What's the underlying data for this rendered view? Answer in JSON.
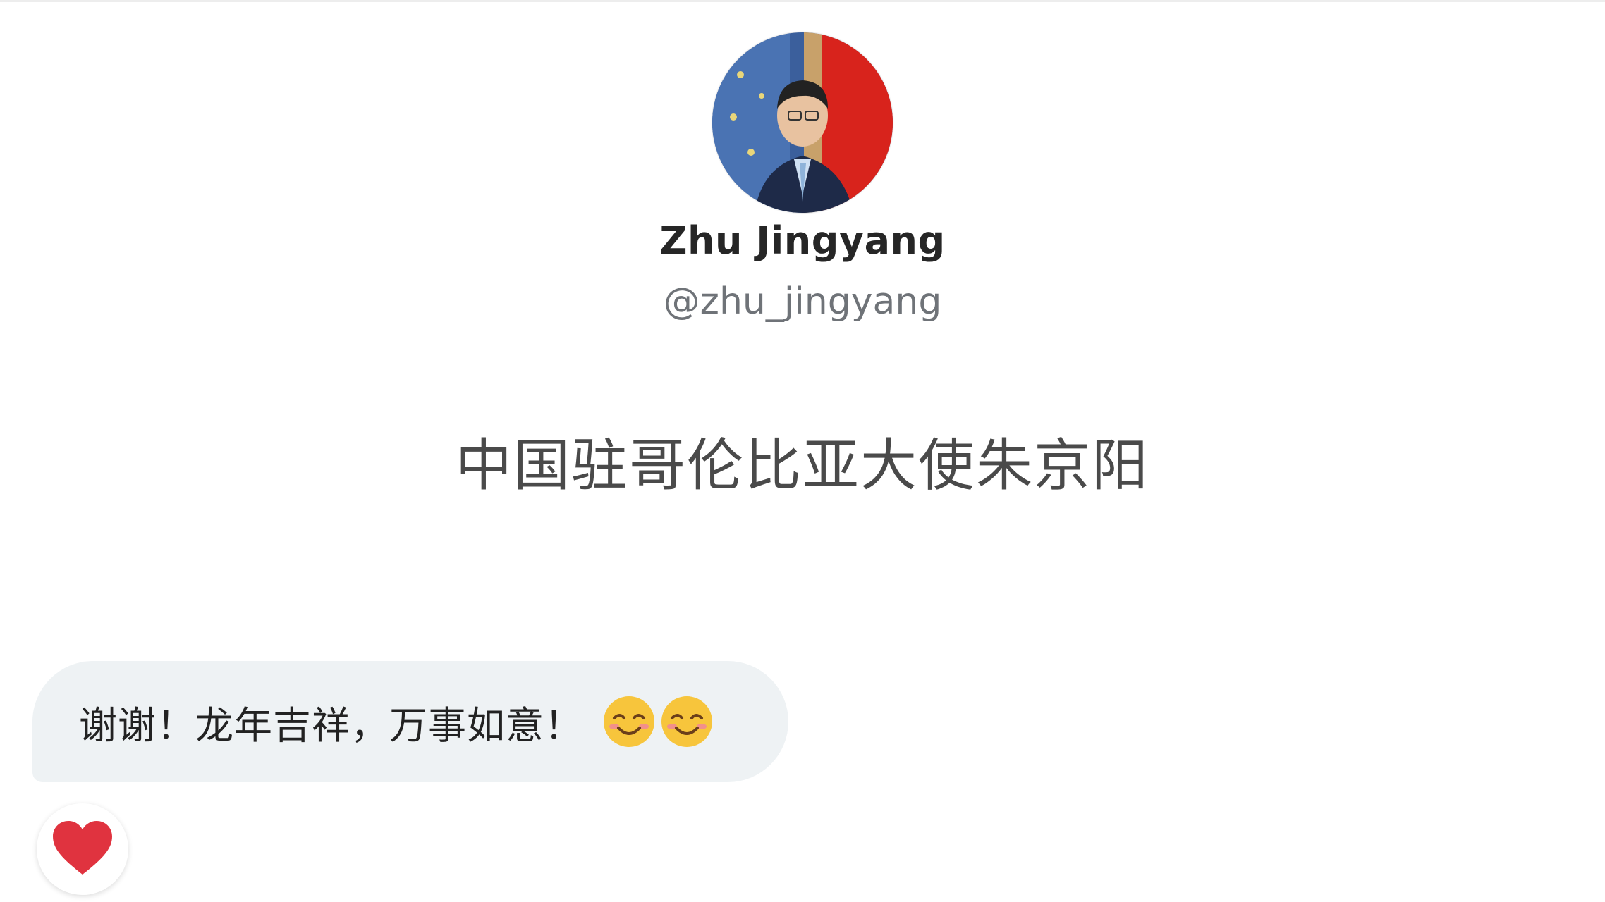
{
  "profile": {
    "display_name": "Zhu Jingyang",
    "handle": "@zhu_jingyang",
    "bio": "中国驻哥伦比亚大使朱京阳"
  },
  "message": {
    "text": "谢谢！龙年吉祥，万事如意！",
    "emojis": [
      "smiling-face-with-smiling-eyes",
      "smiling-face-with-smiling-eyes"
    ]
  },
  "reaction": {
    "icon": "heart-icon",
    "color": "#e0333f"
  },
  "colors": {
    "bubble_background": "#eef2f4",
    "handle_text": "#6f7378",
    "name_text": "#262626"
  }
}
